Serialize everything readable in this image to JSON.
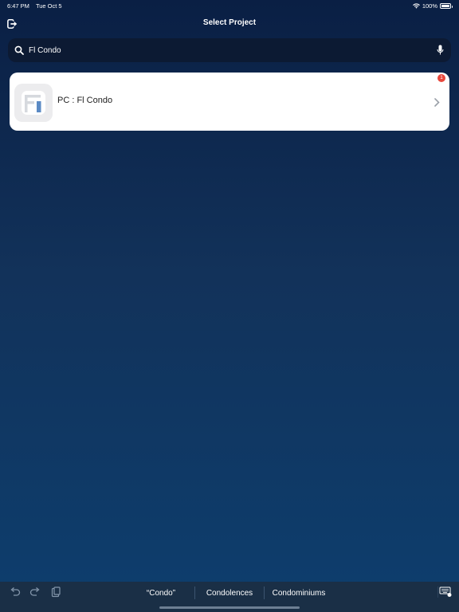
{
  "status_bar": {
    "time": "6:47 PM",
    "date": "Tue Oct 5",
    "battery_percent": "100%",
    "battery_level": 1.0,
    "wifi_icon": "wifi-icon"
  },
  "nav": {
    "title": "Select Project",
    "logout_icon": "logout-icon"
  },
  "search": {
    "value": "Fl Condo",
    "search_icon": "search-icon",
    "mic_icon": "mic-icon"
  },
  "projects": [
    {
      "label": "PC : Fl Condo",
      "badge_count": "1",
      "logo": "app-logo",
      "chevron_icon": "chevron-right-icon"
    }
  ],
  "keyboard": {
    "tools": [
      "undo-icon",
      "redo-icon",
      "paste-icon"
    ],
    "suggestions": [
      "“Condo”",
      "Condolences",
      "Condominiums"
    ],
    "dismiss_icon": "keyboard-dismiss-icon"
  },
  "colors": {
    "background_top": "#0a1f44",
    "background_bottom": "#0d3e6e",
    "search_bg": "#0c1a33",
    "badge": "#e8473c",
    "logo_blue": "#5b8ac4"
  }
}
